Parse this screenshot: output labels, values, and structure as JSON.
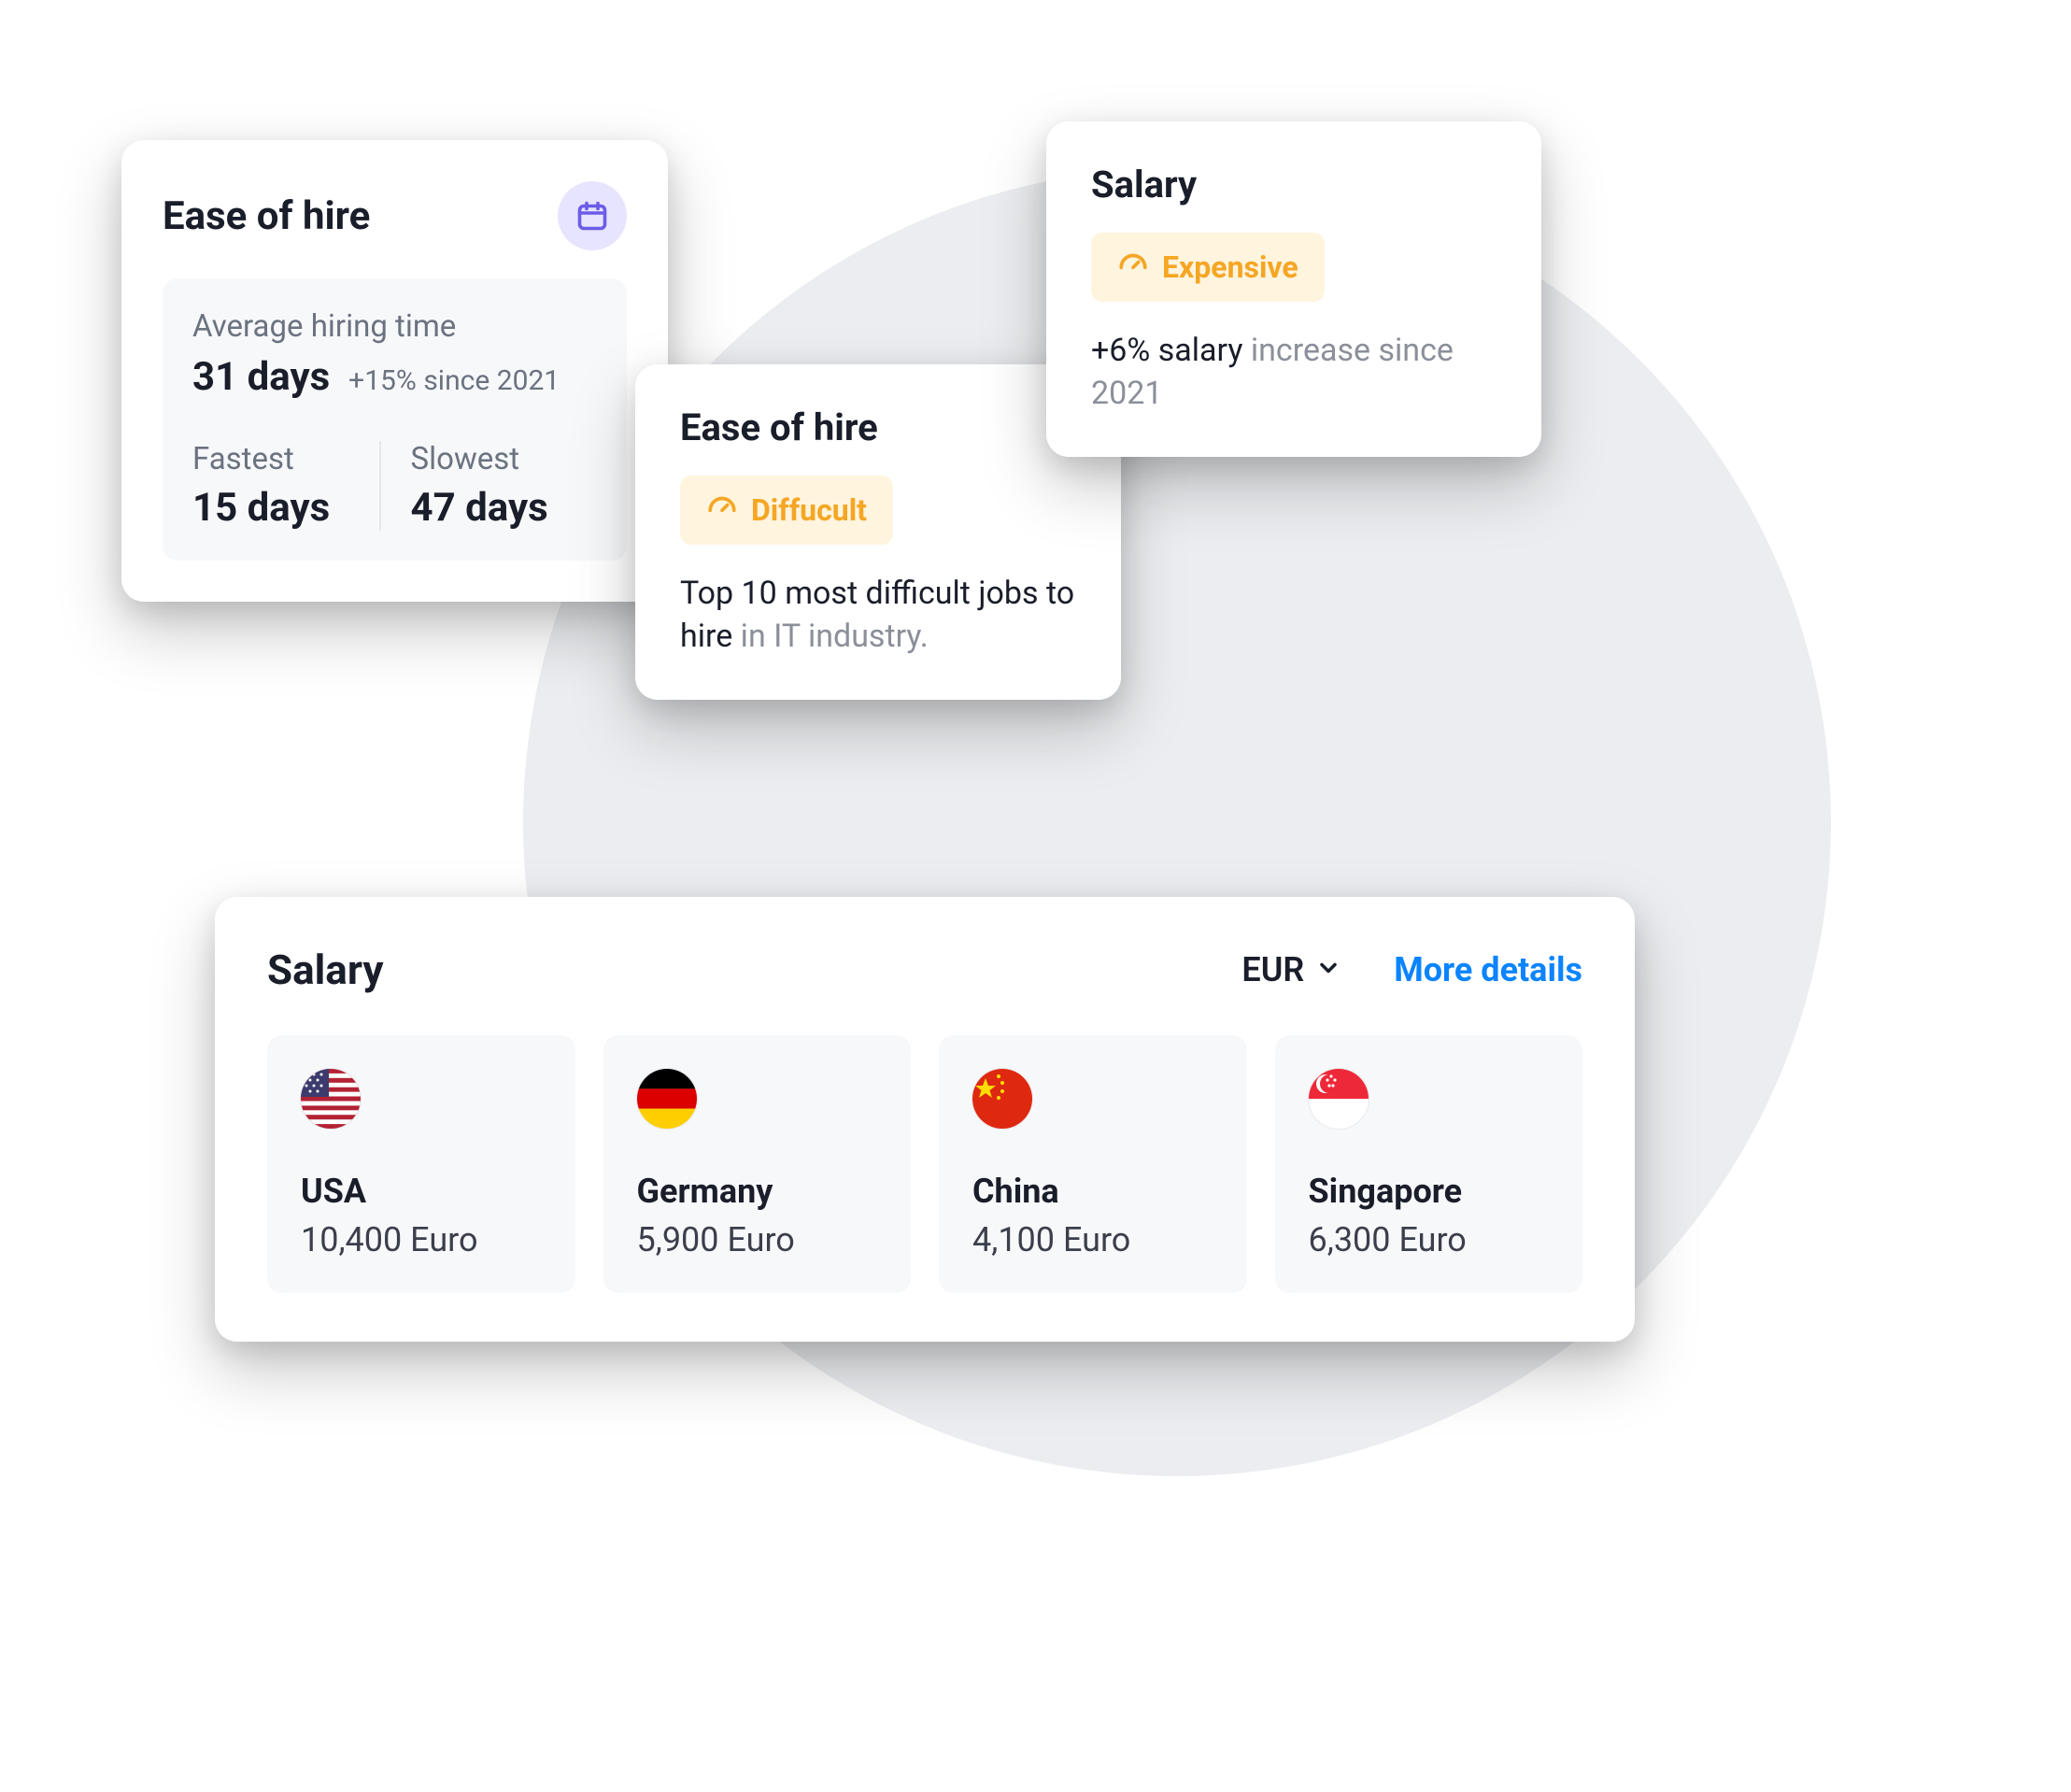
{
  "ease_detail": {
    "title": "Ease of hire",
    "icon": "calendar-icon",
    "avg_label": "Average hiring time",
    "avg_value": "31 days",
    "avg_delta": "+15% since 2021",
    "fastest_label": "Fastest",
    "fastest_value": "15 days",
    "slowest_label": "Slowest",
    "slowest_value": "47 days"
  },
  "ease_badge": {
    "title": "Ease of hire",
    "badge_icon": "gauge-icon",
    "badge_label": "Diffucult",
    "desc_prefix": "Top 10 most difficult jobs to hire ",
    "desc_muted": "in IT industry."
  },
  "salary_badge": {
    "title": "Salary",
    "badge_icon": "gauge-icon",
    "badge_label": "Expensive",
    "desc_strong": "+6% salary ",
    "desc_rest": "increase since 2021"
  },
  "salary_countries_card": {
    "title": "Salary",
    "currency": "EUR",
    "more_link": "More details",
    "countries": [
      {
        "name": "USA",
        "salary": "10,400 Euro",
        "flag": "us"
      },
      {
        "name": "Germany",
        "salary": "5,900 Euro",
        "flag": "de"
      },
      {
        "name": "China",
        "salary": "4,100 Euro",
        "flag": "cn"
      },
      {
        "name": "Singapore",
        "salary": "6,300 Euro",
        "flag": "sg"
      }
    ]
  },
  "colors": {
    "accent_amber": "#f5a623",
    "accent_purple": "#6c5ce7",
    "accent_blue": "#0a84ff"
  }
}
